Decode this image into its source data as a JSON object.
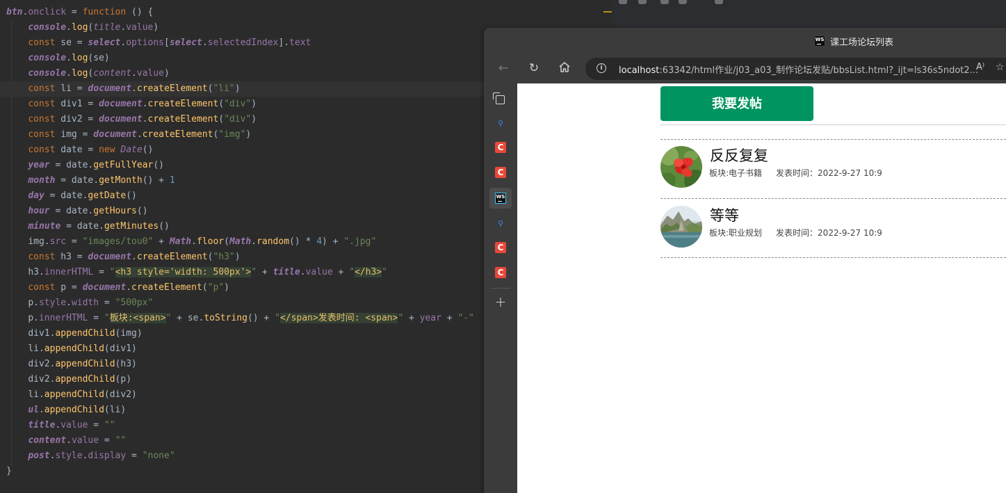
{
  "editor": {
    "lines": [
      [
        {
          "t": "btn",
          "c": "pvb"
        },
        {
          "t": ".",
          "c": ""
        },
        {
          "t": "onclick",
          "c": "pv"
        },
        {
          "t": " = ",
          "c": ""
        },
        {
          "t": "function",
          "c": "kw"
        },
        {
          "t": " () {",
          "c": ""
        }
      ],
      [
        {
          "t": "    ",
          "c": "ind"
        },
        {
          "t": "console",
          "c": "pvb"
        },
        {
          "t": ".",
          "c": ""
        },
        {
          "t": "log",
          "c": "fn"
        },
        {
          "t": "(",
          "c": ""
        },
        {
          "t": "title",
          "c": "pvi"
        },
        {
          "t": ".",
          "c": ""
        },
        {
          "t": "value",
          "c": "pv"
        },
        {
          "t": ")",
          "c": ""
        }
      ],
      [
        {
          "t": "    ",
          "c": "ind"
        },
        {
          "t": "const",
          "c": "kw"
        },
        {
          "t": " se = ",
          "c": ""
        },
        {
          "t": "select",
          "c": "pvb"
        },
        {
          "t": ".",
          "c": ""
        },
        {
          "t": "options",
          "c": "pv"
        },
        {
          "t": "[",
          "c": ""
        },
        {
          "t": "select",
          "c": "pvb"
        },
        {
          "t": ".",
          "c": ""
        },
        {
          "t": "selectedIndex",
          "c": "pv"
        },
        {
          "t": "].",
          "c": ""
        },
        {
          "t": "text",
          "c": "pv"
        }
      ],
      [
        {
          "t": "    ",
          "c": "ind"
        },
        {
          "t": "console",
          "c": "pvb"
        },
        {
          "t": ".",
          "c": ""
        },
        {
          "t": "log",
          "c": "fn"
        },
        {
          "t": "(se)",
          "c": ""
        }
      ],
      [
        {
          "t": "    ",
          "c": "ind"
        },
        {
          "t": "console",
          "c": "pvb"
        },
        {
          "t": ".",
          "c": ""
        },
        {
          "t": "log",
          "c": "fn"
        },
        {
          "t": "(",
          "c": ""
        },
        {
          "t": "content",
          "c": "pvi"
        },
        {
          "t": ".",
          "c": ""
        },
        {
          "t": "value",
          "c": "pv"
        },
        {
          "t": ")",
          "c": ""
        }
      ],
      [
        {
          "t": "    ",
          "c": "ind"
        },
        {
          "t": "const",
          "c": "kw"
        },
        {
          "t": " li = ",
          "c": ""
        },
        {
          "t": "document",
          "c": "pvb"
        },
        {
          "t": ".",
          "c": ""
        },
        {
          "t": "createElement",
          "c": "fn"
        },
        {
          "t": "(",
          "c": ""
        },
        {
          "t": "\"li\"",
          "c": "str"
        },
        {
          "t": ")",
          "c": ""
        }
      ],
      [
        {
          "t": "    ",
          "c": "ind"
        },
        {
          "t": "const",
          "c": "kw"
        },
        {
          "t": " div1 = ",
          "c": ""
        },
        {
          "t": "document",
          "c": "pvb"
        },
        {
          "t": ".",
          "c": ""
        },
        {
          "t": "createElement",
          "c": "fn"
        },
        {
          "t": "(",
          "c": ""
        },
        {
          "t": "\"div\"",
          "c": "str"
        },
        {
          "t": ")",
          "c": ""
        }
      ],
      [
        {
          "t": "    ",
          "c": "ind"
        },
        {
          "t": "const",
          "c": "kw"
        },
        {
          "t": " div2 = ",
          "c": ""
        },
        {
          "t": "document",
          "c": "pvb"
        },
        {
          "t": ".",
          "c": ""
        },
        {
          "t": "createElement",
          "c": "fn"
        },
        {
          "t": "(",
          "c": ""
        },
        {
          "t": "\"div\"",
          "c": "str"
        },
        {
          "t": ")",
          "c": ""
        }
      ],
      [
        {
          "t": "    ",
          "c": "ind"
        },
        {
          "t": "const",
          "c": "kw"
        },
        {
          "t": " img = ",
          "c": ""
        },
        {
          "t": "document",
          "c": "pvb"
        },
        {
          "t": ".",
          "c": ""
        },
        {
          "t": "createElement",
          "c": "fn"
        },
        {
          "t": "(",
          "c": ""
        },
        {
          "t": "\"img\"",
          "c": "str"
        },
        {
          "t": ")",
          "c": ""
        }
      ],
      [
        {
          "t": "    ",
          "c": "ind"
        },
        {
          "t": "const",
          "c": "kw"
        },
        {
          "t": " date = ",
          "c": ""
        },
        {
          "t": "new",
          "c": "kw"
        },
        {
          "t": " ",
          "c": ""
        },
        {
          "t": "Date",
          "c": "pvi"
        },
        {
          "t": "()",
          "c": ""
        }
      ],
      [
        {
          "t": "    ",
          "c": "ind"
        },
        {
          "t": "year",
          "c": "pvb"
        },
        {
          "t": " = date.",
          "c": ""
        },
        {
          "t": "getFullYear",
          "c": "fn"
        },
        {
          "t": "()",
          "c": ""
        }
      ],
      [
        {
          "t": "    ",
          "c": "ind"
        },
        {
          "t": "month",
          "c": "pvb"
        },
        {
          "t": " = date.",
          "c": ""
        },
        {
          "t": "getMonth",
          "c": "fn"
        },
        {
          "t": "() + ",
          "c": ""
        },
        {
          "t": "1",
          "c": "num"
        }
      ],
      [
        {
          "t": "    ",
          "c": "ind"
        },
        {
          "t": "day",
          "c": "pvb"
        },
        {
          "t": " = date.",
          "c": ""
        },
        {
          "t": "getDate",
          "c": "fn"
        },
        {
          "t": "()",
          "c": ""
        }
      ],
      [
        {
          "t": "    ",
          "c": "ind"
        },
        {
          "t": "hour",
          "c": "pvb"
        },
        {
          "t": " = date.",
          "c": ""
        },
        {
          "t": "getHours",
          "c": "fn"
        },
        {
          "t": "()",
          "c": ""
        }
      ],
      [
        {
          "t": "    ",
          "c": "ind"
        },
        {
          "t": "minute",
          "c": "pvb"
        },
        {
          "t": " = date.",
          "c": ""
        },
        {
          "t": "getMinutes",
          "c": "fn"
        },
        {
          "t": "()",
          "c": ""
        }
      ],
      [
        {
          "t": "    ",
          "c": "ind"
        },
        {
          "t": "img.",
          "c": ""
        },
        {
          "t": "src",
          "c": "pv"
        },
        {
          "t": " = ",
          "c": ""
        },
        {
          "t": "\"images/tou0\"",
          "c": "str"
        },
        {
          "t": " + ",
          "c": ""
        },
        {
          "t": "Math",
          "c": "pvb"
        },
        {
          "t": ".",
          "c": ""
        },
        {
          "t": "floor",
          "c": "fn"
        },
        {
          "t": "(",
          "c": ""
        },
        {
          "t": "Math",
          "c": "pvb"
        },
        {
          "t": ".",
          "c": ""
        },
        {
          "t": "random",
          "c": "fn"
        },
        {
          "t": "() * ",
          "c": ""
        },
        {
          "t": "4",
          "c": "num"
        },
        {
          "t": ") + ",
          "c": ""
        },
        {
          "t": "\".jpg\"",
          "c": "str"
        }
      ],
      [
        {
          "t": "    ",
          "c": "ind"
        },
        {
          "t": "const",
          "c": "kw"
        },
        {
          "t": " h3 = ",
          "c": ""
        },
        {
          "t": "document",
          "c": "pvb"
        },
        {
          "t": ".",
          "c": ""
        },
        {
          "t": "createElement",
          "c": "fn"
        },
        {
          "t": "(",
          "c": ""
        },
        {
          "t": "\"h3\"",
          "c": "str"
        },
        {
          "t": ")",
          "c": ""
        }
      ],
      [
        {
          "t": "    ",
          "c": "ind"
        },
        {
          "t": "h3.",
          "c": ""
        },
        {
          "t": "innerHTML",
          "c": "pv"
        },
        {
          "t": " = ",
          "c": ""
        },
        {
          "t": "\"",
          "c": "str"
        },
        {
          "t": "<h3 style='width: 500px'>",
          "c": "tag"
        },
        {
          "t": "\"",
          "c": "str"
        },
        {
          "t": " + ",
          "c": ""
        },
        {
          "t": "title",
          "c": "pvb"
        },
        {
          "t": ".",
          "c": ""
        },
        {
          "t": "value",
          "c": "pv"
        },
        {
          "t": " + ",
          "c": ""
        },
        {
          "t": "\"",
          "c": "str"
        },
        {
          "t": "</h3>",
          "c": "tag"
        },
        {
          "t": "\"",
          "c": "str"
        }
      ],
      [
        {
          "t": "    ",
          "c": "ind"
        },
        {
          "t": "const",
          "c": "kw"
        },
        {
          "t": " p = ",
          "c": ""
        },
        {
          "t": "document",
          "c": "pvb"
        },
        {
          "t": ".",
          "c": ""
        },
        {
          "t": "createElement",
          "c": "fn"
        },
        {
          "t": "(",
          "c": ""
        },
        {
          "t": "\"p\"",
          "c": "str"
        },
        {
          "t": ")",
          "c": ""
        }
      ],
      [
        {
          "t": "    ",
          "c": "ind"
        },
        {
          "t": "p.",
          "c": ""
        },
        {
          "t": "style",
          "c": "pv"
        },
        {
          "t": ".",
          "c": ""
        },
        {
          "t": "width",
          "c": "pv"
        },
        {
          "t": " = ",
          "c": ""
        },
        {
          "t": "\"500px\"",
          "c": "str"
        }
      ],
      [
        {
          "t": "    ",
          "c": "ind"
        },
        {
          "t": "p.",
          "c": ""
        },
        {
          "t": "innerHTML",
          "c": "pv"
        },
        {
          "t": " = ",
          "c": ""
        },
        {
          "t": "\"",
          "c": "str"
        },
        {
          "t": "板块:<span>",
          "c": "tag"
        },
        {
          "t": "\"",
          "c": "str"
        },
        {
          "t": " + se.",
          "c": ""
        },
        {
          "t": "toString",
          "c": "fn"
        },
        {
          "t": "() + ",
          "c": ""
        },
        {
          "t": "\"",
          "c": "str"
        },
        {
          "t": "</span>发表时间: <span>",
          "c": "tag"
        },
        {
          "t": "\"",
          "c": "str"
        },
        {
          "t": " + ",
          "c": ""
        },
        {
          "t": "year",
          "c": "pv"
        },
        {
          "t": " + ",
          "c": ""
        },
        {
          "t": "\"-\"",
          "c": "str"
        }
      ],
      [
        {
          "t": "    ",
          "c": "ind"
        },
        {
          "t": "div1.",
          "c": ""
        },
        {
          "t": "appendChild",
          "c": "fn"
        },
        {
          "t": "(img)",
          "c": ""
        }
      ],
      [
        {
          "t": "    ",
          "c": "ind"
        },
        {
          "t": "li.",
          "c": ""
        },
        {
          "t": "appendChild",
          "c": "fn"
        },
        {
          "t": "(div1)",
          "c": ""
        }
      ],
      [
        {
          "t": "    ",
          "c": "ind"
        },
        {
          "t": "div2.",
          "c": ""
        },
        {
          "t": "appendChild",
          "c": "fn"
        },
        {
          "t": "(h3)",
          "c": ""
        }
      ],
      [
        {
          "t": "    ",
          "c": "ind"
        },
        {
          "t": "div2.",
          "c": ""
        },
        {
          "t": "appendChild",
          "c": "fn"
        },
        {
          "t": "(p)",
          "c": ""
        }
      ],
      [
        {
          "t": "    ",
          "c": "ind"
        },
        {
          "t": "li.",
          "c": ""
        },
        {
          "t": "appendChild",
          "c": "fn"
        },
        {
          "t": "(div2)",
          "c": ""
        }
      ],
      [
        {
          "t": "    ",
          "c": "ind"
        },
        {
          "t": "ul",
          "c": "pvb"
        },
        {
          "t": ".",
          "c": ""
        },
        {
          "t": "appendChild",
          "c": "fn"
        },
        {
          "t": "(li)",
          "c": ""
        }
      ],
      [
        {
          "t": "    ",
          "c": "ind"
        },
        {
          "t": "title",
          "c": "pvb"
        },
        {
          "t": ".",
          "c": ""
        },
        {
          "t": "value",
          "c": "pv"
        },
        {
          "t": " = ",
          "c": ""
        },
        {
          "t": "\"\"",
          "c": "str"
        }
      ],
      [
        {
          "t": "    ",
          "c": "ind"
        },
        {
          "t": "content",
          "c": "pvb"
        },
        {
          "t": ".",
          "c": ""
        },
        {
          "t": "value",
          "c": "pv"
        },
        {
          "t": " = ",
          "c": ""
        },
        {
          "t": "\"\"",
          "c": "str"
        }
      ],
      [
        {
          "t": "    ",
          "c": "ind"
        },
        {
          "t": "post",
          "c": "pvb"
        },
        {
          "t": ".",
          "c": ""
        },
        {
          "t": "style",
          "c": "pv"
        },
        {
          "t": ".",
          "c": ""
        },
        {
          "t": "display",
          "c": "pv"
        },
        {
          "t": " = ",
          "c": ""
        },
        {
          "t": "\"none\"",
          "c": "str"
        }
      ],
      [
        {
          "t": "}",
          "c": ""
        }
      ]
    ]
  },
  "browser": {
    "window_title": "课工场论坛列表",
    "favicon_label": "WS",
    "url_host": "localhost",
    "url_rest": ":63342/html作业/j03_a03_制作论坛发贴/bbsList.html?_ijt=ls36s5ndot2...",
    "read_aloud_glyph": "A⁾",
    "sidebar": {
      "c_label": "C",
      "ws_label": "WS"
    }
  },
  "page": {
    "post_button_label": "我要发帖",
    "posts": [
      {
        "title": "反反复复",
        "board": "板块:电子书籍",
        "time": "发表时间：2022-9-27 10:9",
        "avatar": "red-flower"
      },
      {
        "title": "等等",
        "board": "板块:职业规划",
        "time": "发表时间：2022-9-27 10:9",
        "avatar": "lake-rocks"
      }
    ]
  },
  "colors": {
    "editor_bg": "#2b2b2b",
    "post_button": "#00945f",
    "keyword": "#cc7832",
    "string": "#6a8759",
    "function": "#ffc66d",
    "property": "#9876aa"
  }
}
